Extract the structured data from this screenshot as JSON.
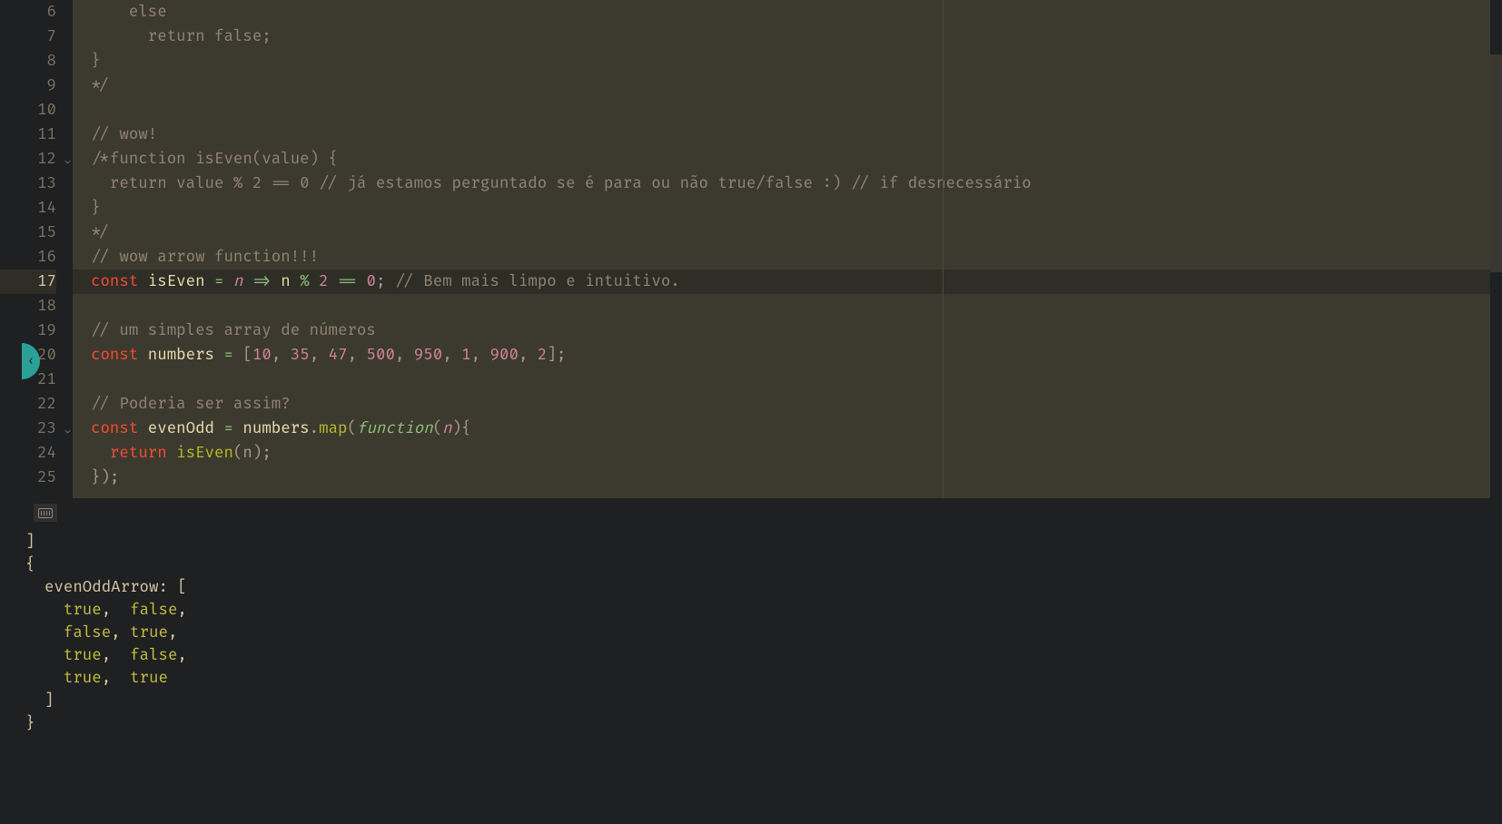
{
  "gutter": {
    "start": 6,
    "end": 25,
    "current": 17,
    "fold_lines": [
      12,
      23
    ]
  },
  "code": [
    {
      "n": 6,
      "tokens": [
        [
          "    ",
          "ident"
        ],
        [
          "else",
          "comment"
        ]
      ]
    },
    {
      "n": 7,
      "tokens": [
        [
          "      return false;",
          "comment"
        ]
      ]
    },
    {
      "n": 8,
      "tokens": [
        [
          "}",
          "comment"
        ]
      ]
    },
    {
      "n": 9,
      "tokens": [
        [
          "*/",
          "comment"
        ]
      ]
    },
    {
      "n": 10,
      "tokens": [
        [
          "",
          "ident"
        ]
      ]
    },
    {
      "n": 11,
      "tokens": [
        [
          "// wow!",
          "comment"
        ]
      ]
    },
    {
      "n": 12,
      "tokens": [
        [
          "/*function isEven(value) {",
          "comment"
        ]
      ]
    },
    {
      "n": 13,
      "tokens": [
        [
          "  return value % 2 == 0 // já estamos perguntado se é para ou não true/false :) // if desnecessário",
          "comment"
        ]
      ]
    },
    {
      "n": 14,
      "tokens": [
        [
          "}",
          "comment"
        ]
      ]
    },
    {
      "n": 15,
      "tokens": [
        [
          "*/",
          "comment"
        ]
      ]
    },
    {
      "n": 16,
      "tokens": [
        [
          "// wow arrow function!!!",
          "comment"
        ]
      ]
    },
    {
      "n": 17,
      "tokens": [
        [
          "const ",
          "const"
        ],
        [
          "isEven ",
          "ident"
        ],
        [
          "= ",
          "op"
        ],
        [
          "n ",
          "param"
        ],
        [
          "=> ",
          "op"
        ],
        [
          "n ",
          "ident"
        ],
        [
          "% ",
          "op"
        ],
        [
          "2 ",
          "num"
        ],
        [
          "== ",
          "op"
        ],
        [
          "0",
          "num"
        ],
        [
          "; ",
          "punct"
        ],
        [
          "// Bem mais limpo e intuitivo.",
          "comment"
        ]
      ]
    },
    {
      "n": 18,
      "tokens": [
        [
          "",
          "ident"
        ]
      ]
    },
    {
      "n": 19,
      "tokens": [
        [
          "// um simples array de números",
          "comment"
        ]
      ]
    },
    {
      "n": 20,
      "tokens": [
        [
          "const ",
          "const"
        ],
        [
          "numbers ",
          "ident"
        ],
        [
          "= ",
          "op"
        ],
        [
          "[",
          "punct"
        ],
        [
          "10",
          "num"
        ],
        [
          ", ",
          "punct"
        ],
        [
          "35",
          "num"
        ],
        [
          ", ",
          "punct"
        ],
        [
          "47",
          "num"
        ],
        [
          ", ",
          "punct"
        ],
        [
          "500",
          "num"
        ],
        [
          ", ",
          "punct"
        ],
        [
          "950",
          "num"
        ],
        [
          ", ",
          "punct"
        ],
        [
          "1",
          "num"
        ],
        [
          ", ",
          "punct"
        ],
        [
          "900",
          "num"
        ],
        [
          ", ",
          "punct"
        ],
        [
          "2",
          "num"
        ],
        [
          "];",
          "punct"
        ]
      ]
    },
    {
      "n": 21,
      "tokens": [
        [
          "",
          "ident"
        ]
      ]
    },
    {
      "n": 22,
      "tokens": [
        [
          "// Poderia ser assim?",
          "comment"
        ]
      ]
    },
    {
      "n": 23,
      "tokens": [
        [
          "const ",
          "const"
        ],
        [
          "evenOdd ",
          "ident"
        ],
        [
          "= ",
          "op"
        ],
        [
          "numbers",
          "ident"
        ],
        [
          ".",
          "punct"
        ],
        [
          "map",
          "funccall"
        ],
        [
          "(",
          "punct"
        ],
        [
          "function",
          "funckw"
        ],
        [
          "(",
          "punct"
        ],
        [
          "n",
          "param"
        ],
        [
          "){",
          "punct"
        ]
      ]
    },
    {
      "n": 24,
      "tokens": [
        [
          "  ",
          "ident"
        ],
        [
          "return ",
          "return"
        ],
        [
          "isEven",
          "funccall"
        ],
        [
          "(n);",
          "punct"
        ]
      ]
    },
    {
      "n": 25,
      "tokens": [
        [
          "});",
          "punct"
        ]
      ]
    }
  ],
  "console": {
    "lines": [
      "]",
      "{",
      "  evenOddArrow: [",
      "    true,  false,",
      "    false, true,",
      "    true,  false,",
      "    true,  true",
      "  ]",
      "}"
    ],
    "key": "evenOddArrow",
    "values": [
      [
        "true",
        "false"
      ],
      [
        "false",
        "true"
      ],
      [
        "true",
        "false"
      ],
      [
        "true",
        "true"
      ]
    ]
  }
}
